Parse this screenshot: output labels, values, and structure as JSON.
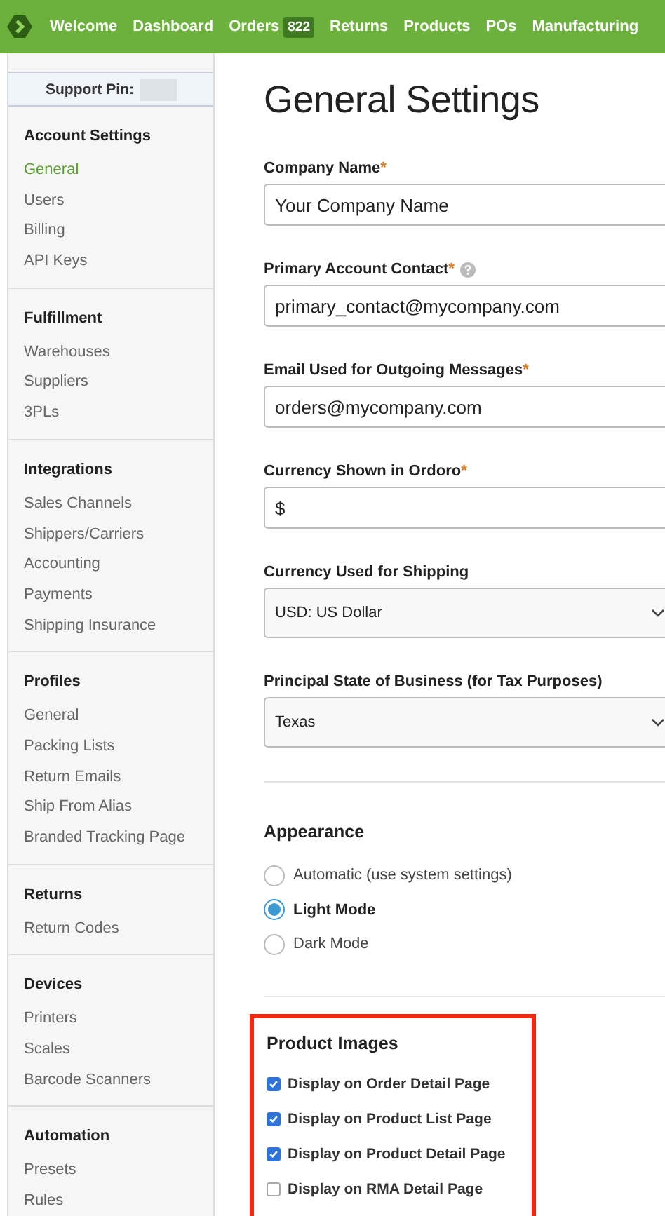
{
  "nav": {
    "items": [
      {
        "label": "Welcome"
      },
      {
        "label": "Dashboard"
      },
      {
        "label": "Orders",
        "badge": "822"
      },
      {
        "label": "Returns"
      },
      {
        "label": "Products"
      },
      {
        "label": "POs"
      },
      {
        "label": "Manufacturing"
      }
    ]
  },
  "sidebar": {
    "support_pin_label": "Support Pin:",
    "groups": [
      {
        "title": "Account Settings",
        "items": [
          {
            "label": "General",
            "selected": true
          },
          {
            "label": "Users",
            "selected": false
          },
          {
            "label": "Billing",
            "selected": false
          },
          {
            "label": "API Keys",
            "selected": false
          }
        ]
      },
      {
        "title": "Fulfillment",
        "items": [
          {
            "label": "Warehouses",
            "selected": false
          },
          {
            "label": "Suppliers",
            "selected": false
          },
          {
            "label": "3PLs",
            "selected": false
          }
        ]
      },
      {
        "title": "Integrations",
        "items": [
          {
            "label": "Sales Channels",
            "selected": false
          },
          {
            "label": "Shippers/Carriers",
            "selected": false
          },
          {
            "label": "Accounting",
            "selected": false
          },
          {
            "label": "Payments",
            "selected": false
          },
          {
            "label": "Shipping Insurance",
            "selected": false
          }
        ]
      },
      {
        "title": "Profiles",
        "items": [
          {
            "label": "General",
            "selected": false
          },
          {
            "label": "Packing Lists",
            "selected": false
          },
          {
            "label": "Return Emails",
            "selected": false
          },
          {
            "label": "Ship From Alias",
            "selected": false
          },
          {
            "label": "Branded Tracking Page",
            "selected": false
          }
        ]
      },
      {
        "title": "Returns",
        "items": [
          {
            "label": "Return Codes",
            "selected": false
          }
        ]
      },
      {
        "title": "Devices",
        "items": [
          {
            "label": "Printers",
            "selected": false
          },
          {
            "label": "Scales",
            "selected": false
          },
          {
            "label": "Barcode Scanners",
            "selected": false
          }
        ]
      },
      {
        "title": "Automation",
        "items": [
          {
            "label": "Presets",
            "selected": false
          },
          {
            "label": "Rules",
            "selected": false
          }
        ]
      }
    ]
  },
  "main": {
    "title": "General Settings",
    "fields": [
      {
        "kind": "text",
        "label": "Company Name",
        "required_mark": "*",
        "help_icon": false,
        "value": "Your Company Name"
      },
      {
        "kind": "text",
        "label": "Primary Account Contact",
        "required_mark": "*",
        "help_icon": true,
        "value": "primary_contact@mycompany.com"
      },
      {
        "kind": "text",
        "label": "Email Used for Outgoing Messages",
        "required_mark": "*",
        "help_icon": false,
        "value": "orders@mycompany.com"
      },
      {
        "kind": "text",
        "label": "Currency Shown in Ordoro",
        "required_mark": "*",
        "help_icon": false,
        "value": "$"
      },
      {
        "kind": "select",
        "label": "Currency Used for Shipping",
        "help_icon": false,
        "value": "USD: US Dollar"
      },
      {
        "kind": "select",
        "label": "Principal State of Business (for Tax Purposes)",
        "help_icon": false,
        "value": "Texas"
      }
    ],
    "appearance": {
      "title": "Appearance",
      "options": [
        {
          "label": "Automatic (use system settings)",
          "selected": false
        },
        {
          "label": "Light Mode",
          "selected": true
        },
        {
          "label": "Dark Mode",
          "selected": false
        }
      ]
    },
    "product_images": {
      "title": "Product Images",
      "highlighted": true,
      "options": [
        {
          "label": "Display on Order Detail Page",
          "checked": true
        },
        {
          "label": "Display on Product List Page",
          "checked": true
        },
        {
          "label": "Display on Product Detail Page",
          "checked": true
        },
        {
          "label": "Display on RMA Detail Page",
          "checked": false
        }
      ]
    }
  }
}
